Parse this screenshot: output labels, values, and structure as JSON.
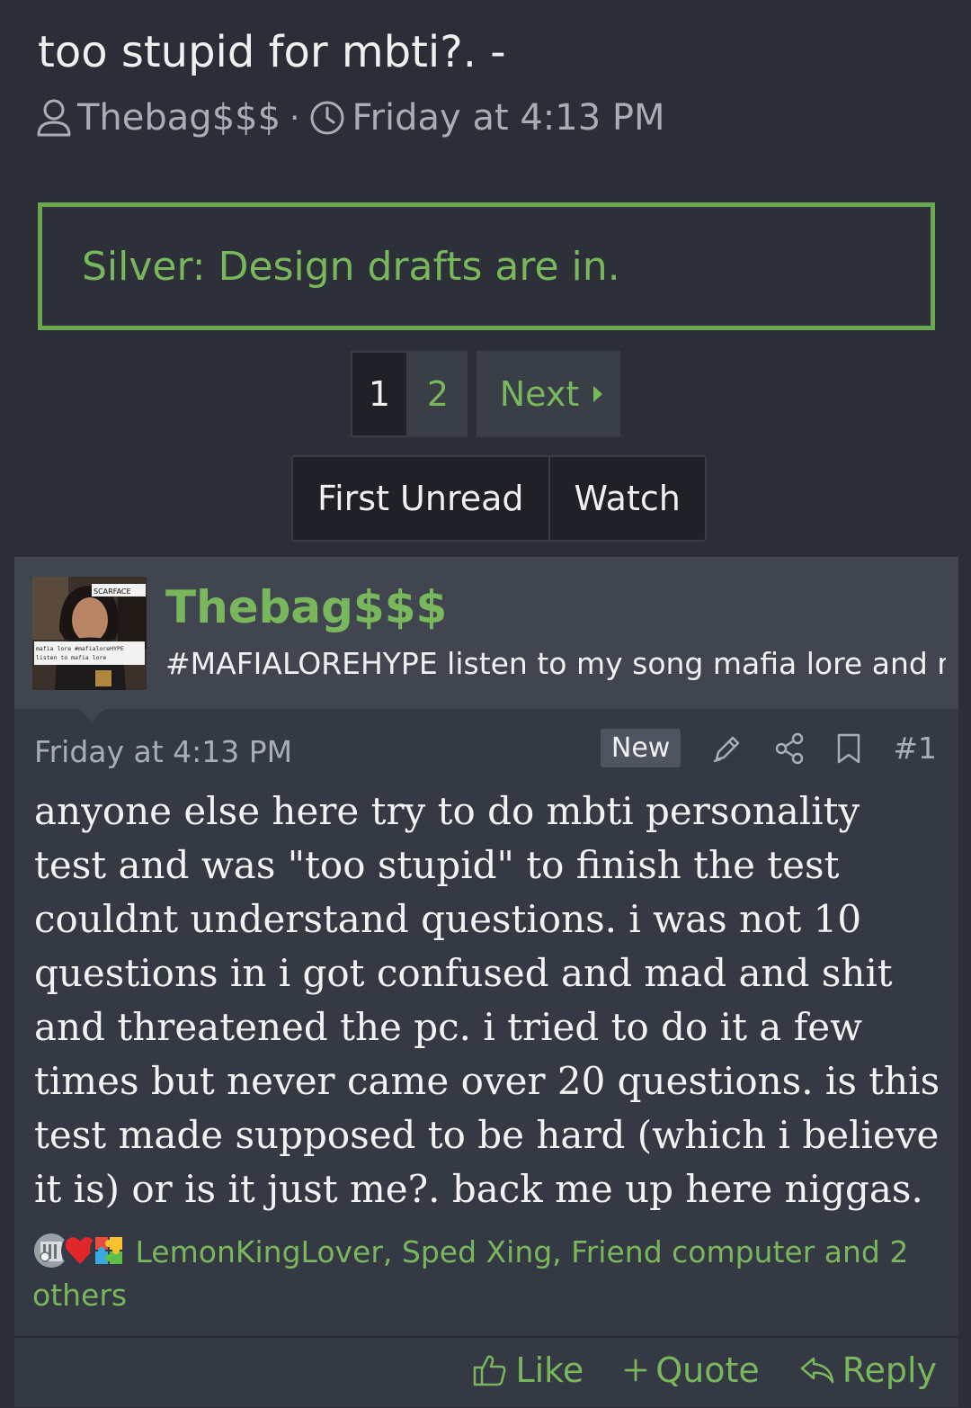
{
  "thread": {
    "title": "too stupid for mbti?. -",
    "author": "Thebag$$$",
    "date": "Friday at 4:13 PM",
    "separator": "·"
  },
  "notice": {
    "text": "Silver: Design drafts are in."
  },
  "pagination": {
    "current": "1",
    "pages": [
      "2"
    ],
    "next_label": "Next"
  },
  "buttons": {
    "first_unread": "First Unread",
    "watch": "Watch"
  },
  "post": {
    "username": "Thebag$$$",
    "user_title": "#MAFIALOREHYPE listen to my song mafia lore and ma",
    "avatar": {
      "caption_top": "SCARFACE",
      "caption_bottom_1": "mafia lore #mafialoreHYPE",
      "caption_bottom_2": "listen to mafia lore"
    },
    "date": "Friday at 4:13 PM",
    "badge": "New",
    "number": "#1",
    "body": "anyone else here try to do mbti personality test and was \"too stupid\" to finish the test couldnt understand questions. i was not 10 questions in i got confused and mad and shit and threatened the pc. i tried to do it a few times but never came over 20 questions. is this test made supposed to be hard (which i believe it is) or is it just me?. back me up here niggas.",
    "reactions_text": "LemonKingLover, Sped Xing, Friend computer and 2 others",
    "reaction_icons": [
      "column-icon",
      "heart-icon",
      "puzzle-icon"
    ]
  },
  "footer": {
    "like": "Like",
    "quote": "Quote",
    "reply": "Reply"
  },
  "colors": {
    "background": "#2b2e36",
    "accent_green": "#79b75c",
    "notice_border": "#6aa84f",
    "post_bg": "#353943",
    "user_bg": "#41454f"
  }
}
